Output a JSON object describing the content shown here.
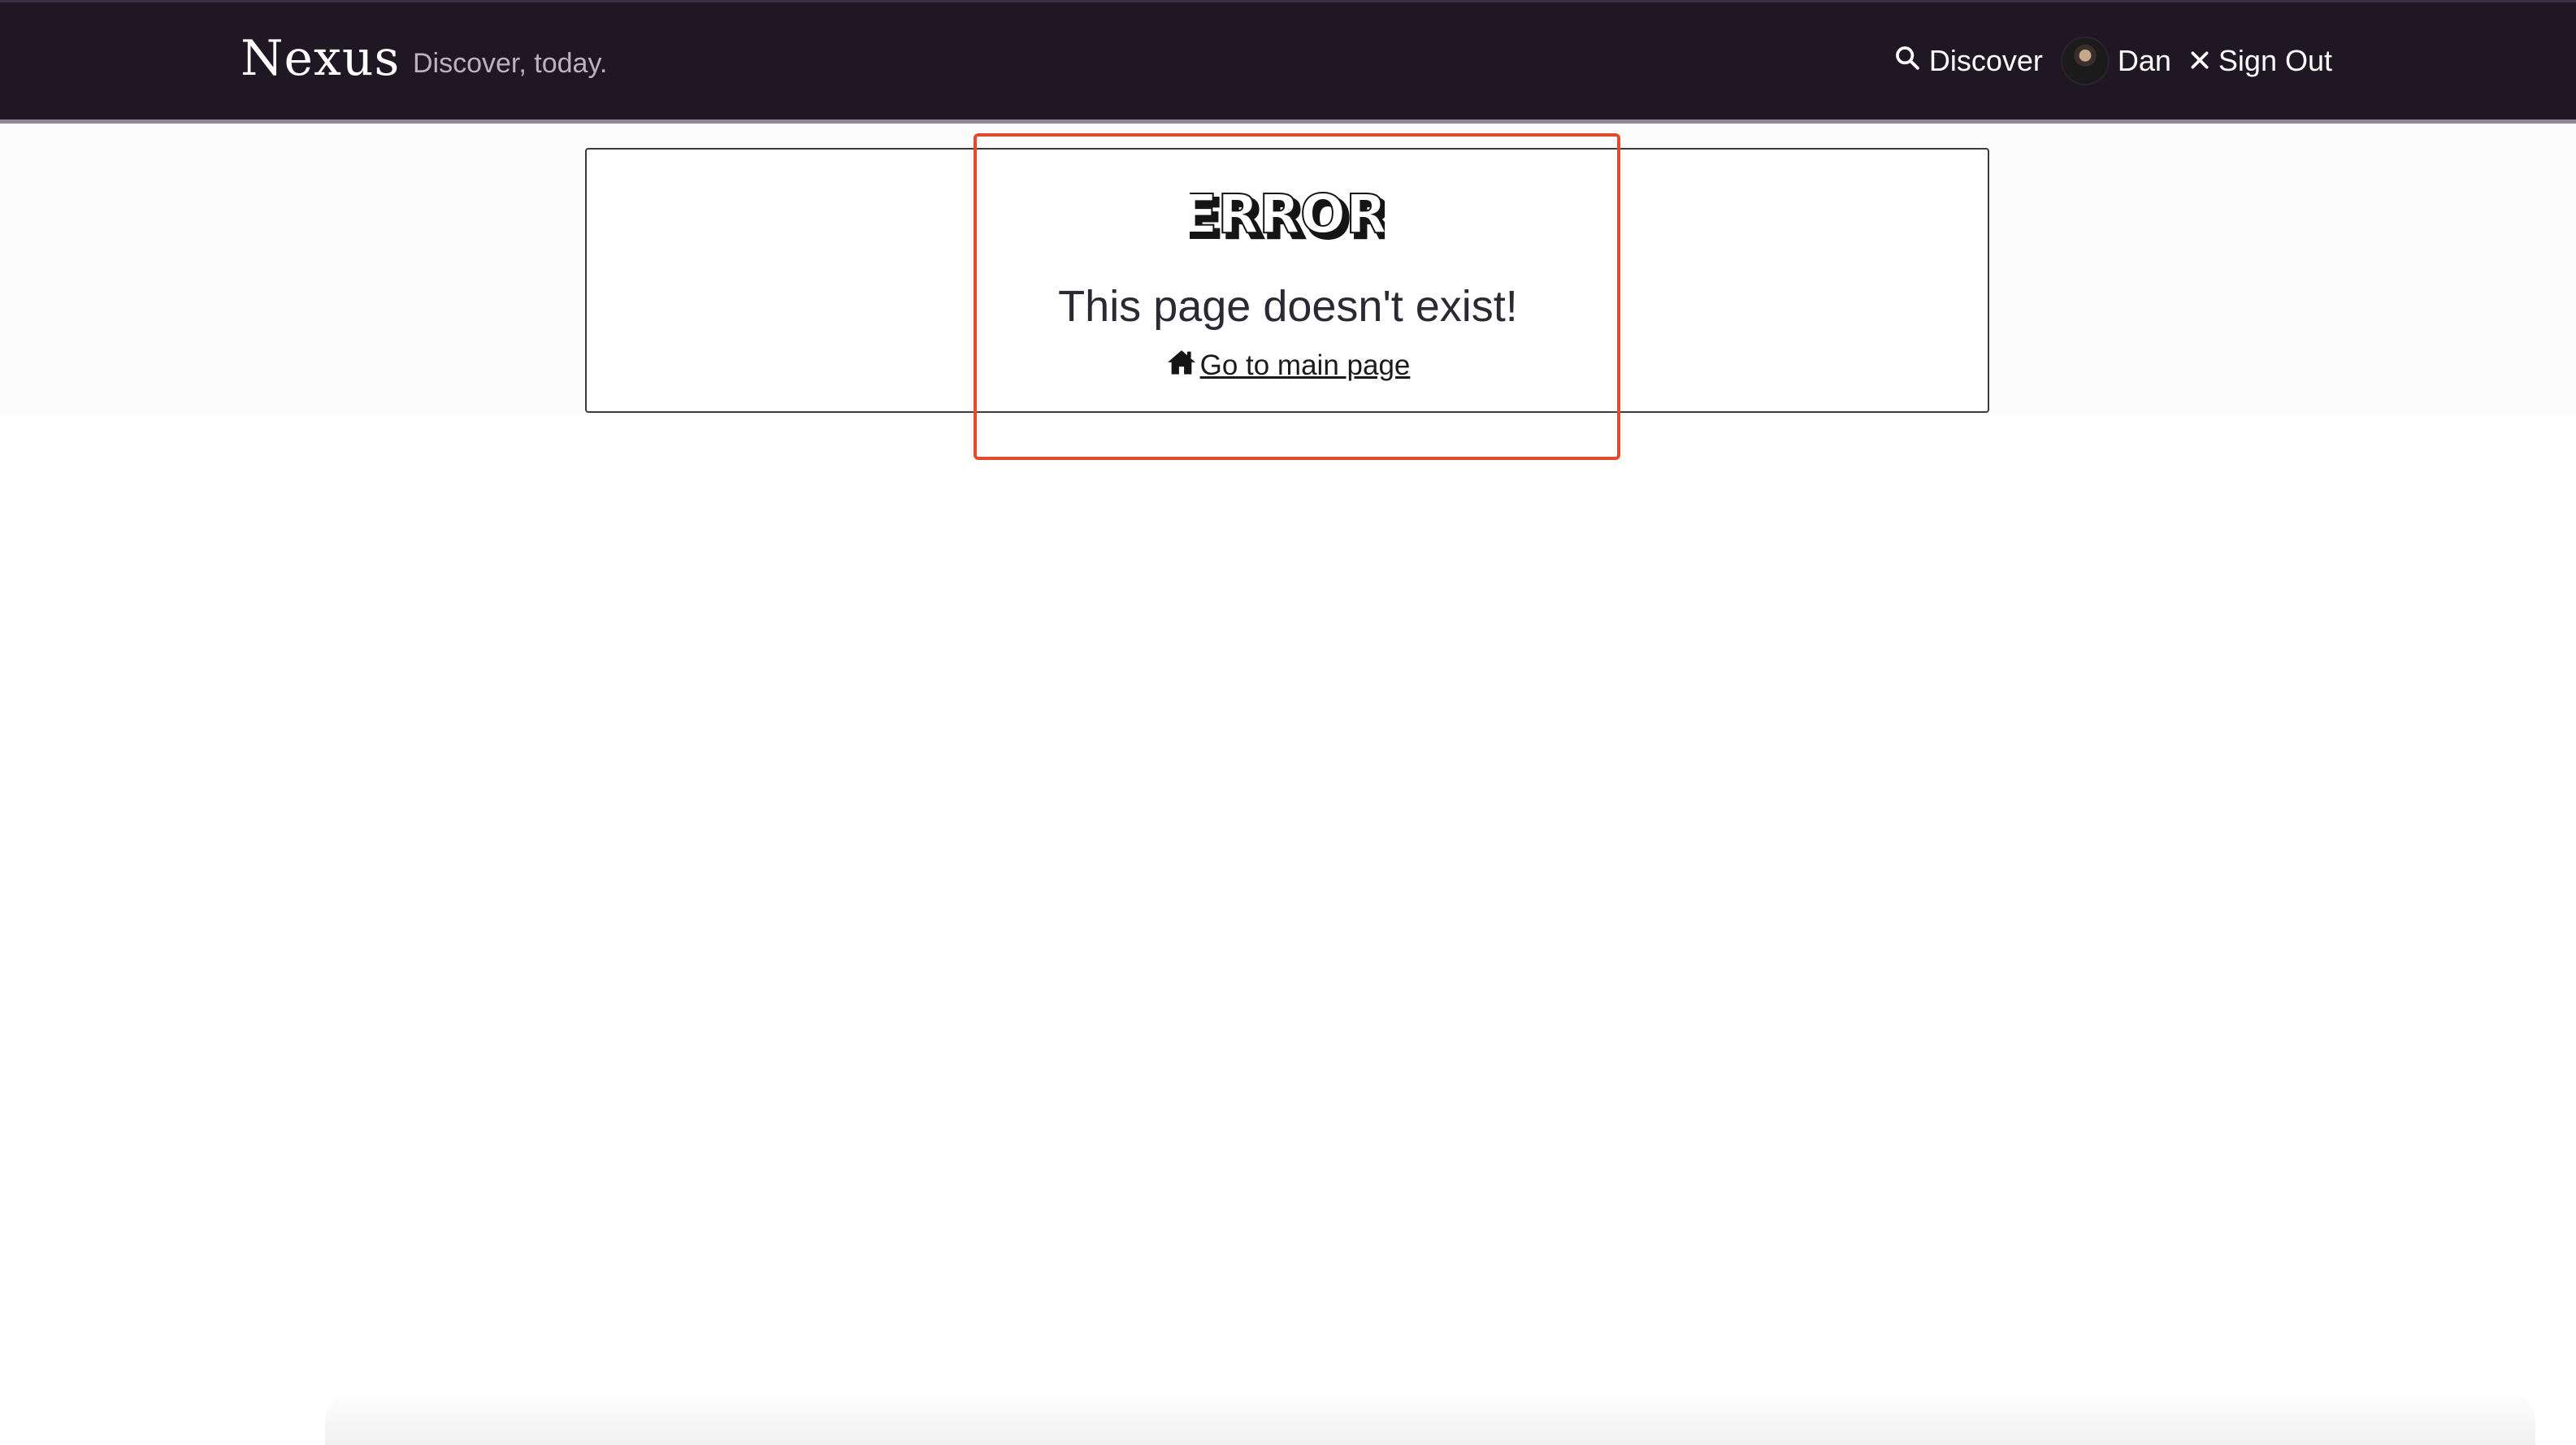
{
  "header": {
    "brand": "Nexus",
    "tagline": "Discover, today.",
    "discover_label": "Discover",
    "user_name": "Dan",
    "signout_label": "Sign Out"
  },
  "error": {
    "logo_text": "ERROR",
    "message": "This page doesn't exist!",
    "home_link_label": " Go to main page"
  },
  "icons": {
    "discover": "search-icon",
    "signout": "close-icon",
    "home": "home-icon",
    "user": "avatar"
  },
  "colors": {
    "header_bg": "#1f1724",
    "highlight": "#e24a2b",
    "text_dark": "#2a2a33"
  }
}
